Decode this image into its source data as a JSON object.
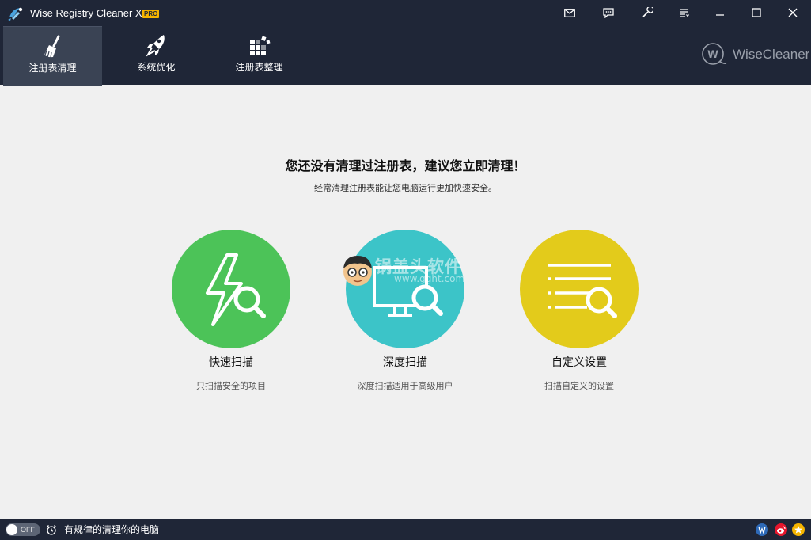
{
  "window": {
    "title": "Wise Registry Cleaner X",
    "badge": "PRO"
  },
  "titlebar_buttons": [
    {
      "name": "mail-icon"
    },
    {
      "name": "feedback-icon"
    },
    {
      "name": "skin-icon"
    },
    {
      "name": "menu-icon"
    },
    {
      "name": "minimize-icon"
    },
    {
      "name": "maximize-icon"
    },
    {
      "name": "close-icon"
    }
  ],
  "nav": {
    "tabs": [
      {
        "label": "注册表清理",
        "icon": "broom-icon",
        "active": true
      },
      {
        "label": "系统优化",
        "icon": "rocket-icon",
        "active": false
      },
      {
        "label": "注册表整理",
        "icon": "blocks-icon",
        "active": false
      }
    ]
  },
  "brand": {
    "text": "WiseCleaner",
    "logo_letter": "W"
  },
  "main": {
    "headline": "您还没有清理过注册表，建议您立即清理！",
    "subline": "经常清理注册表能让您电脑运行更加快速安全。",
    "scans": [
      {
        "title": "快速扫描",
        "desc": "只扫描安全的项目",
        "color": "#4cc358",
        "icon": "lightning-search-icon"
      },
      {
        "title": "深度扫描",
        "desc": "深度扫描适用于高级用户",
        "color": "#3cc4c8",
        "icon": "monitor-search-icon"
      },
      {
        "title": "自定义设置",
        "desc": "扫描自定义的设置",
        "color": "#e3cb1b",
        "icon": "list-search-icon"
      }
    ]
  },
  "watermark": {
    "text": "锅盖头软件",
    "url": "www.gght.com"
  },
  "statusbar": {
    "toggle_label": "OFF",
    "schedule_text": "有规律的清理你的电脑",
    "social": [
      {
        "name": "homepage-icon",
        "color": "#2e6ab8"
      },
      {
        "name": "weibo-icon",
        "color": "#e6162d"
      },
      {
        "name": "rate-icon",
        "color": "#f5b400"
      }
    ]
  },
  "colors": {
    "header_bg": "#1f2637",
    "active_tab_bg": "#3a4354",
    "body_bg": "#f0f0f0"
  }
}
